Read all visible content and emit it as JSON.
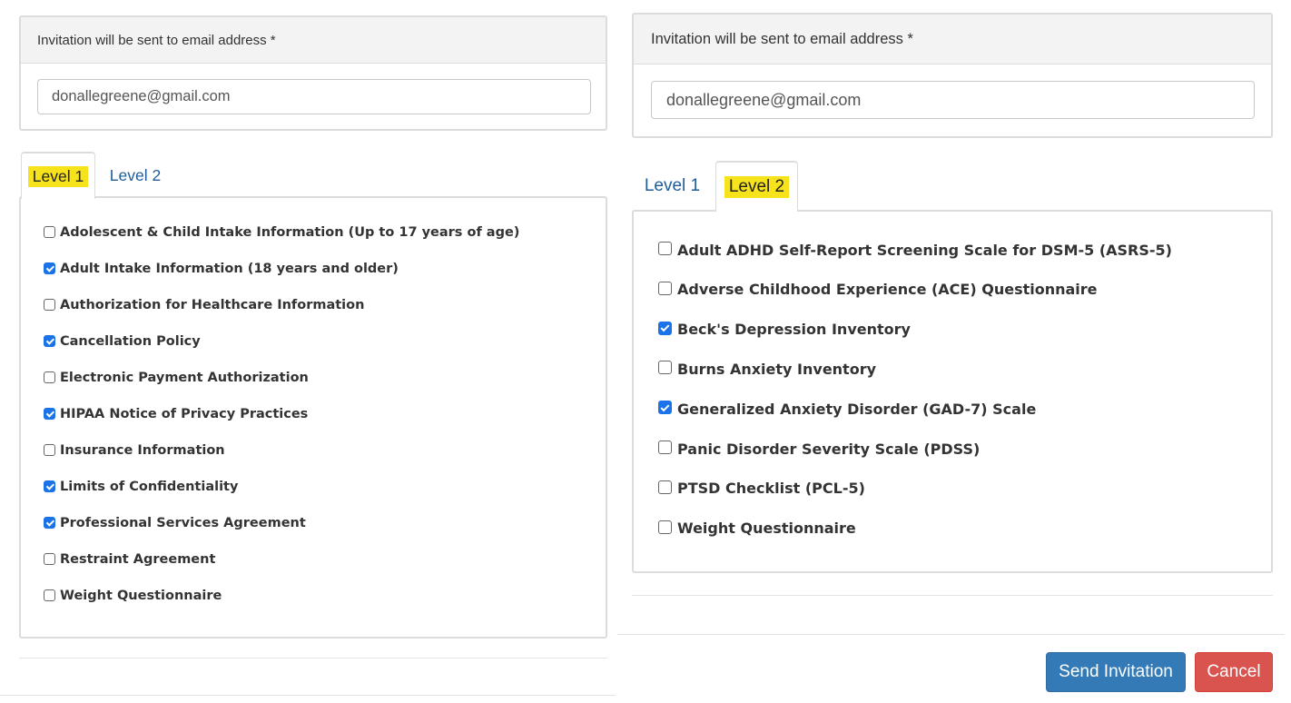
{
  "left": {
    "email_label": "Invitation will be sent to email address *",
    "email_value": "donallegreene@gmail.com",
    "tabs": [
      {
        "label": "Level 1",
        "active": true,
        "highlighted": true
      },
      {
        "label": "Level 2",
        "active": false,
        "highlighted": false
      }
    ],
    "items": [
      {
        "label": "Adolescent & Child Intake Information (Up to 17 years of age)",
        "checked": false
      },
      {
        "label": "Adult Intake Information (18 years and older)",
        "checked": true
      },
      {
        "label": "Authorization for Healthcare Information",
        "checked": false
      },
      {
        "label": "Cancellation Policy",
        "checked": true
      },
      {
        "label": "Electronic Payment Authorization",
        "checked": false
      },
      {
        "label": "HIPAA Notice of Privacy Practices",
        "checked": true
      },
      {
        "label": "Insurance Information",
        "checked": false
      },
      {
        "label": "Limits of Confidentiality",
        "checked": true
      },
      {
        "label": "Professional Services Agreement",
        "checked": true
      },
      {
        "label": "Restraint Agreement",
        "checked": false
      },
      {
        "label": "Weight Questionnaire",
        "checked": false
      }
    ]
  },
  "right": {
    "email_label": "Invitation will be sent to email address *",
    "email_value": "donallegreene@gmail.com",
    "tabs": [
      {
        "label": "Level 1",
        "active": false,
        "highlighted": false
      },
      {
        "label": "Level 2",
        "active": true,
        "highlighted": true
      }
    ],
    "items": [
      {
        "label": "Adult ADHD Self-Report Screening Scale for DSM-5 (ASRS-5)",
        "checked": false
      },
      {
        "label": "Adverse Childhood Experience (ACE) Questionnaire",
        "checked": false
      },
      {
        "label": "Beck's Depression Inventory",
        "checked": true
      },
      {
        "label": "Burns Anxiety Inventory",
        "checked": false
      },
      {
        "label": "Generalized Anxiety Disorder (GAD-7) Scale",
        "checked": true
      },
      {
        "label": "Panic Disorder Severity Scale (PDSS)",
        "checked": false
      },
      {
        "label": "PTSD Checklist (PCL-5)",
        "checked": false
      },
      {
        "label": "Weight Questionnaire",
        "checked": false
      }
    ]
  },
  "actions": {
    "send_label": "Send Invitation",
    "cancel_label": "Cancel"
  },
  "colors": {
    "highlight": "#f7e31c",
    "primary": "#337ab7",
    "danger": "#d9534f",
    "checkbox_checked": "#1a73e8",
    "tab_link": "#1f5c99"
  }
}
